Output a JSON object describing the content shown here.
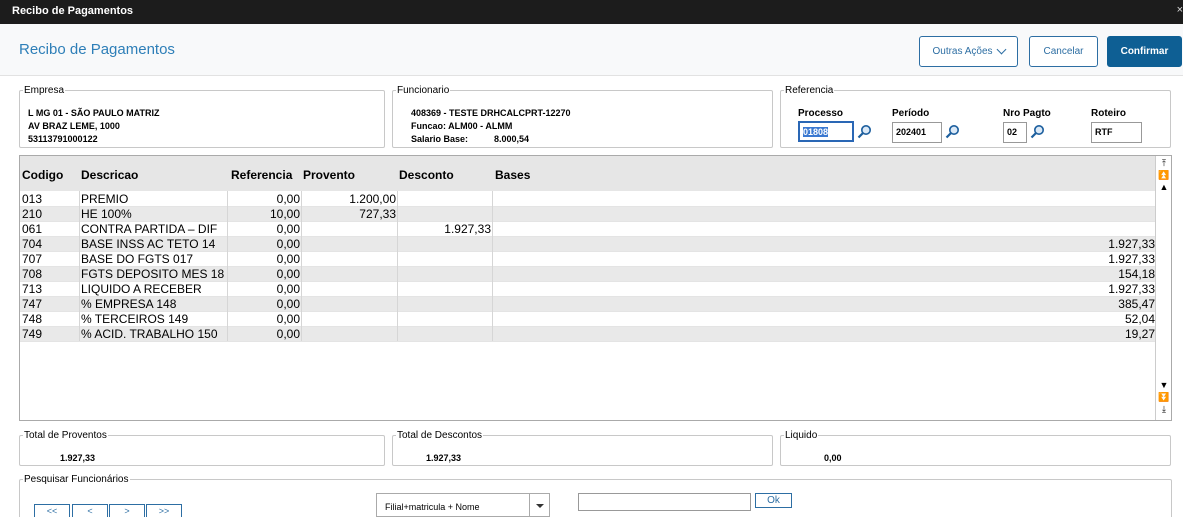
{
  "window": {
    "title": "Recibo de Pagamentos",
    "close": "×"
  },
  "header": {
    "title": "Recibo de Pagamentos",
    "outras_acoes": "Outras Ações",
    "cancelar": "Cancelar",
    "confirmar": "Confirmar"
  },
  "empresa": {
    "legend": "Empresa",
    "line1": "L MG 01  - SÃO PAULO MATRIZ",
    "line2": "AV BRAZ LEME, 1000",
    "line3": "53113791000122"
  },
  "funcionario": {
    "legend": "Funcionario",
    "line1": "408369 - TESTE DRHCALCPRT-12270",
    "line2": "Funcao: ALM00 - ALMM",
    "salario_label": "Salario Base:",
    "salario_value": "8.000,54"
  },
  "referencia": {
    "legend": "Referencia",
    "processo_label": "Processo",
    "processo_value": "01808",
    "periodo_label": "Período",
    "periodo_value": "202401",
    "nro_pagto_label": "Nro Pagto",
    "nro_pagto_value": "02",
    "roteiro_label": "Roteiro",
    "roteiro_value": "RTF"
  },
  "grid": {
    "columns": [
      "Codigo",
      "Descricao",
      "Referencia",
      "Provento",
      "Desconto",
      "Bases"
    ],
    "rows": [
      [
        "013",
        "PREMIO",
        "0,00",
        "1.200,00",
        "",
        ""
      ],
      [
        "210",
        "HE 100%",
        "10,00",
        "727,33",
        "",
        ""
      ],
      [
        "061",
        "CONTRA PARTIDA – DIF",
        "0,00",
        "",
        "1.927,33",
        ""
      ],
      [
        "704",
        "BASE INSS AC TETO 14",
        "0,00",
        "",
        "",
        "1.927,33"
      ],
      [
        "707",
        "BASE DO FGTS 017",
        "0,00",
        "",
        "",
        "1.927,33"
      ],
      [
        "708",
        "FGTS DEPOSITO MES 18",
        "0,00",
        "",
        "",
        "154,18"
      ],
      [
        "713",
        "LIQUIDO A RECEBER",
        "0,00",
        "",
        "",
        "1.927,33"
      ],
      [
        "747",
        "% EMPRESA 148",
        "0,00",
        "",
        "",
        "385,47"
      ],
      [
        "748",
        "% TERCEIROS 149",
        "0,00",
        "",
        "",
        "52,04"
      ],
      [
        "749",
        "% ACID. TRABALHO 150",
        "0,00",
        "",
        "",
        "19,27"
      ]
    ]
  },
  "totais": {
    "proventos_label": "Total de Proventos",
    "proventos_value": "1.927,33",
    "descontos_label": "Total de Descontos",
    "descontos_value": "1.927,33",
    "liquido_label": "Liquido",
    "liquido_value": "0,00"
  },
  "pesquisa": {
    "legend": "Pesquisar Funcionários",
    "nav": [
      "<<",
      "<",
      ">",
      ">>"
    ],
    "ordem": "Filial+matricula + Nome",
    "ok": "Ok"
  }
}
